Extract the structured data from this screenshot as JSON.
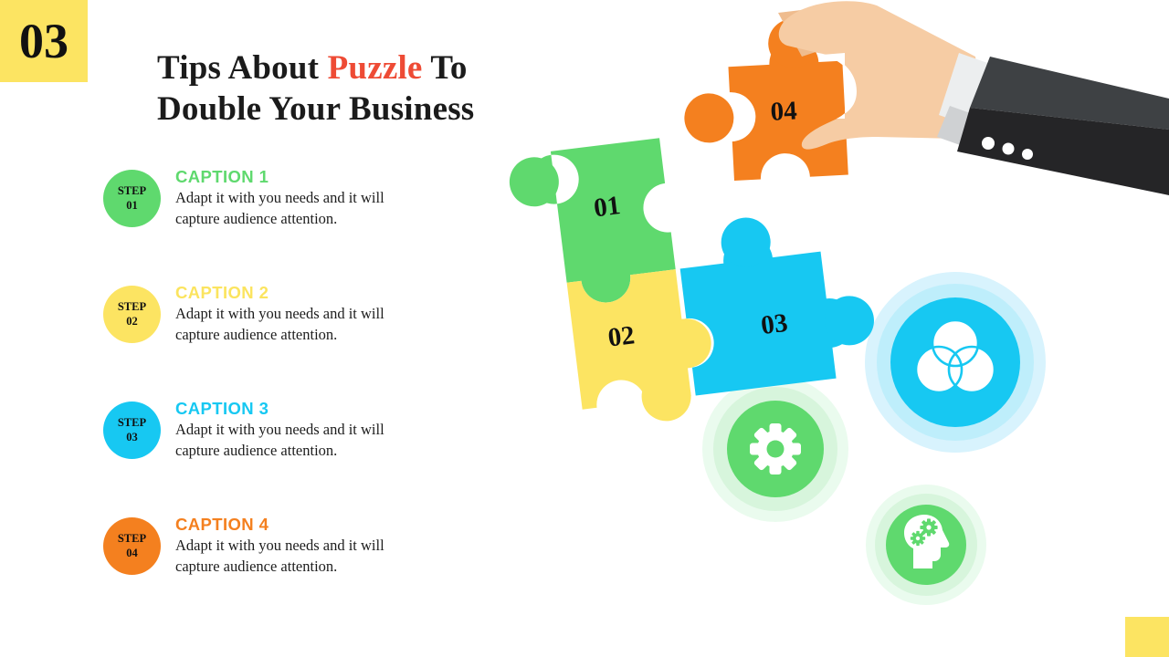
{
  "badge": {
    "number": "03"
  },
  "title": {
    "before": "Tips About ",
    "highlight": "Puzzle",
    "after": " To Double Your Business",
    "highlight_color": "#EE4B35"
  },
  "steps": [
    {
      "step_label": "STEP",
      "step_number": "01",
      "caption": "CAPTION 1",
      "description": "Adapt it with you needs and it will capture audience attention.",
      "color": "#5FD96E"
    },
    {
      "step_label": "STEP",
      "step_number": "02",
      "caption": "CAPTION 2",
      "description": "Adapt it with you needs and it will capture audience attention.",
      "color": "#FCE462"
    },
    {
      "step_label": "STEP",
      "step_number": "03",
      "caption": "CAPTION 3",
      "description": "Adapt it with you needs and it will capture audience attention.",
      "color": "#17C8F2"
    },
    {
      "step_label": "STEP",
      "step_number": "04",
      "caption": "CAPTION 4",
      "description": "Adapt it with you needs and it will capture audience attention.",
      "color": "#F4801F"
    }
  ],
  "puzzle": {
    "pieces": [
      {
        "number": "01",
        "color": "#5FD96E"
      },
      {
        "number": "02",
        "color": "#FCE462"
      },
      {
        "number": "03",
        "color": "#17C8F2"
      },
      {
        "number": "04",
        "color": "#F4801F"
      }
    ]
  },
  "hand": {
    "skin_color": "#F6CCA4",
    "skin_shadow": "#EFBC8E",
    "cuff_color": "#ECEEEF",
    "cuff_shadow": "#CFD1D3",
    "sleeve_top_color": "#3E4144",
    "sleeve_bottom_color": "#252527",
    "button_color": "#FFFFFF",
    "button_count": "3"
  },
  "icons": [
    {
      "name": "venn-diagram-icon",
      "color": "#17C8F2",
      "halo_color": "#BEEEFB"
    },
    {
      "name": "gear-icon",
      "color": "#5FD96E",
      "halo_color": "#D7F5DC"
    },
    {
      "name": "head-gears-icon",
      "color": "#5FD96E",
      "halo_color": "#D7F5DC"
    }
  ],
  "background_color": "#FFFFFF"
}
